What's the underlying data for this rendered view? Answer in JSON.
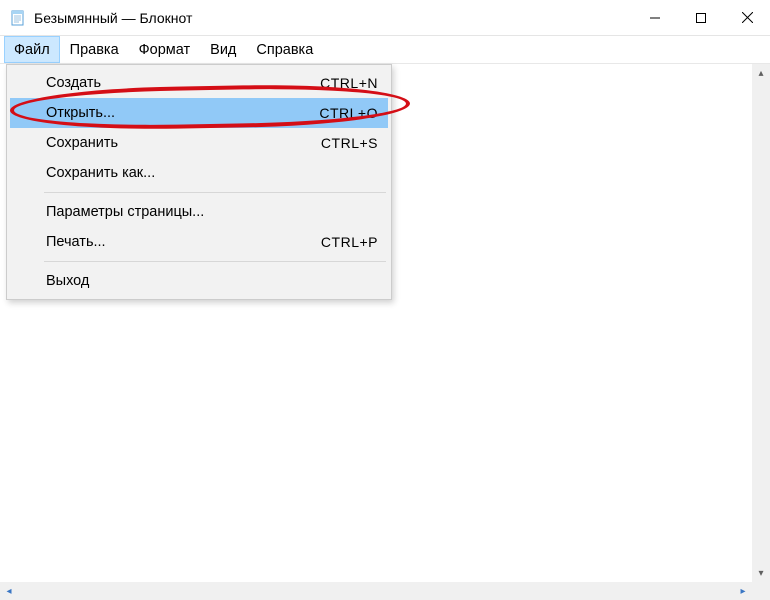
{
  "window": {
    "title": "Безымянный — Блокнот"
  },
  "menubar": {
    "items": [
      {
        "label": "Файл"
      },
      {
        "label": "Правка"
      },
      {
        "label": "Формат"
      },
      {
        "label": "Вид"
      },
      {
        "label": "Справка"
      }
    ]
  },
  "dropdown": {
    "items": [
      {
        "label": "Создать",
        "shortcut": "CTRL+N"
      },
      {
        "label": "Открыть...",
        "shortcut": "CTRL+O",
        "highlighted": true,
        "annotated": true
      },
      {
        "label": "Сохранить",
        "shortcut": "CTRL+S"
      },
      {
        "label": "Сохранить как..."
      },
      {
        "sep": true
      },
      {
        "label": "Параметры страницы..."
      },
      {
        "label": "Печать...",
        "shortcut": "CTRL+P"
      },
      {
        "sep": true
      },
      {
        "label": "Выход"
      }
    ]
  }
}
